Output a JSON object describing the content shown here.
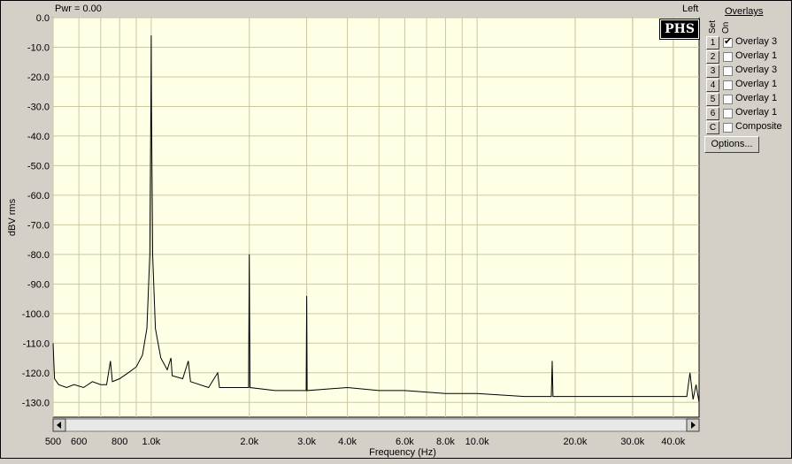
{
  "header": {
    "power_label": "Pwr = 0.00",
    "channel_label": "Left"
  },
  "brand": {
    "logo_text": "PHS"
  },
  "overlays_panel": {
    "title": "Overlays",
    "set_label": "Set",
    "on_label": "On",
    "items": [
      {
        "set": "1",
        "checked": true,
        "label": "Overlay 3"
      },
      {
        "set": "2",
        "checked": false,
        "label": "Overlay 1"
      },
      {
        "set": "3",
        "checked": false,
        "label": "Overlay 3"
      },
      {
        "set": "4",
        "checked": false,
        "label": "Overlay 1"
      },
      {
        "set": "5",
        "checked": false,
        "label": "Overlay 1"
      },
      {
        "set": "6",
        "checked": false,
        "label": "Overlay 1"
      },
      {
        "set": "C",
        "checked": false,
        "label": "Composite"
      }
    ],
    "options_label": "Options..."
  },
  "chart_data": {
    "type": "line",
    "xlabel": "Frequency (Hz)",
    "ylabel": "dBV rms",
    "xscale": "log",
    "xlim": [
      500,
      48000
    ],
    "ylim": [
      -135,
      0
    ],
    "yticks": [
      0,
      -10,
      -20,
      -30,
      -40,
      -50,
      -60,
      -70,
      -80,
      -90,
      -100,
      -110,
      -120,
      -130
    ],
    "ytick_labels": [
      "0.0",
      "-10.0",
      "-20.0",
      "-30.0",
      "-40.0",
      "-50.0",
      "-60.0",
      "-70.0",
      "-80.0",
      "-90.0",
      "-100.0",
      "-110.0",
      "-120.0",
      "-130.0"
    ],
    "xticks": [
      500,
      600,
      800,
      1000,
      2000,
      3000,
      4000,
      6000,
      8000,
      10000,
      20000,
      30000,
      40000
    ],
    "xtick_labels": [
      "500",
      "600",
      "800",
      "1.0k",
      "2.0k",
      "3.0k",
      "4.0k",
      "6.0k",
      "8.0k",
      "10.0k",
      "20.0k",
      "30.0k",
      "40.0k"
    ],
    "grid": true,
    "colors": {
      "background": "#ffffe6",
      "grid": "#c8c8a0",
      "trace": "#000000"
    },
    "series": [
      {
        "values": [
          {
            "x": 500,
            "y": -110
          },
          {
            "x": 505,
            "y": -122
          },
          {
            "x": 520,
            "y": -124
          },
          {
            "x": 550,
            "y": -125
          },
          {
            "x": 580,
            "y": -124
          },
          {
            "x": 620,
            "y": -125
          },
          {
            "x": 660,
            "y": -123
          },
          {
            "x": 700,
            "y": -124
          },
          {
            "x": 730,
            "y": -124
          },
          {
            "x": 750,
            "y": -116
          },
          {
            "x": 760,
            "y": -123
          },
          {
            "x": 800,
            "y": -122
          },
          {
            "x": 850,
            "y": -120
          },
          {
            "x": 900,
            "y": -118
          },
          {
            "x": 940,
            "y": -114
          },
          {
            "x": 970,
            "y": -105
          },
          {
            "x": 990,
            "y": -80
          },
          {
            "x": 998,
            "y": -30
          },
          {
            "x": 1000,
            "y": -6
          },
          {
            "x": 1002,
            "y": -30
          },
          {
            "x": 1010,
            "y": -80
          },
          {
            "x": 1030,
            "y": -105
          },
          {
            "x": 1070,
            "y": -115
          },
          {
            "x": 1120,
            "y": -119
          },
          {
            "x": 1150,
            "y": -115
          },
          {
            "x": 1160,
            "y": -121
          },
          {
            "x": 1250,
            "y": -122
          },
          {
            "x": 1300,
            "y": -116
          },
          {
            "x": 1320,
            "y": -123
          },
          {
            "x": 1500,
            "y": -125
          },
          {
            "x": 1600,
            "y": -120
          },
          {
            "x": 1620,
            "y": -125
          },
          {
            "x": 1990,
            "y": -125
          },
          {
            "x": 2000,
            "y": -80
          },
          {
            "x": 2010,
            "y": -125
          },
          {
            "x": 2400,
            "y": -126
          },
          {
            "x": 2990,
            "y": -126
          },
          {
            "x": 3000,
            "y": -94
          },
          {
            "x": 3010,
            "y": -126
          },
          {
            "x": 4000,
            "y": -125
          },
          {
            "x": 5000,
            "y": -126
          },
          {
            "x": 6000,
            "y": -126
          },
          {
            "x": 8000,
            "y": -127
          },
          {
            "x": 10000,
            "y": -127
          },
          {
            "x": 14000,
            "y": -128
          },
          {
            "x": 16900,
            "y": -128
          },
          {
            "x": 17000,
            "y": -116
          },
          {
            "x": 17100,
            "y": -128
          },
          {
            "x": 25000,
            "y": -128
          },
          {
            "x": 35000,
            "y": -128
          },
          {
            "x": 44000,
            "y": -128
          },
          {
            "x": 45000,
            "y": -120
          },
          {
            "x": 46000,
            "y": -129
          },
          {
            "x": 47000,
            "y": -124
          },
          {
            "x": 48000,
            "y": -130
          }
        ]
      }
    ]
  }
}
